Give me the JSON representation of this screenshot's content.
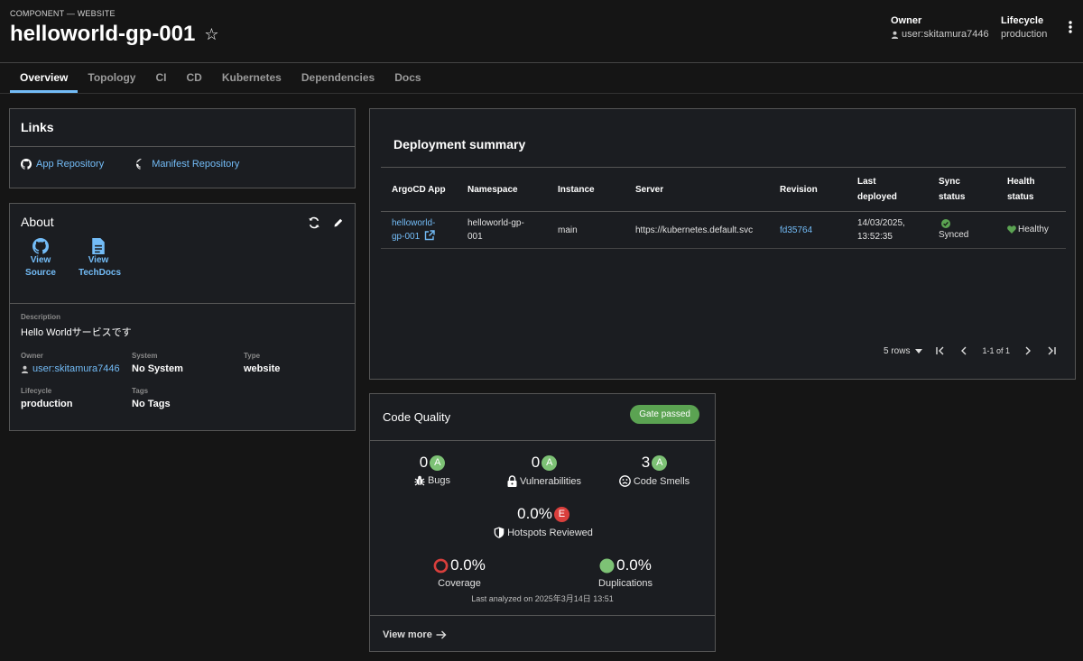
{
  "header": {
    "kind": "COMPONENT — WEBSITE",
    "title": "helloworld-gp-001",
    "owner_label": "Owner",
    "owner_value": "user:skitamura7446",
    "lifecycle_label": "Lifecycle",
    "lifecycle_value": "production"
  },
  "tabs": [
    "Overview",
    "Topology",
    "CI",
    "CD",
    "Kubernetes",
    "Dependencies",
    "Docs"
  ],
  "links": {
    "title": "Links",
    "items": [
      "App Repository",
      "Manifest Repository"
    ]
  },
  "about": {
    "title": "About",
    "view_source": "View Source",
    "view_techdocs": "View TechDocs",
    "description_label": "Description",
    "description": "Hello Worldサービスです",
    "owner_label": "Owner",
    "owner": "user:skitamura7446",
    "system_label": "System",
    "system": "No System",
    "type_label": "Type",
    "type": "website",
    "lifecycle_label": "Lifecycle",
    "lifecycle": "production",
    "tags_label": "Tags",
    "tags": "No Tags"
  },
  "deployment": {
    "title": "Deployment summary",
    "columns": [
      "ArgoCD App",
      "Namespace",
      "Instance",
      "Server",
      "Revision",
      "Last deployed",
      "Sync status",
      "Health status"
    ],
    "row": {
      "app": "helloworld-gp-001",
      "namespace": "helloworld-gp-001",
      "instance": "main",
      "server": "https://kubernetes.default.svc",
      "revision": "fd35764",
      "last_deployed_date": "14/03/2025,",
      "last_deployed_time": "13:52:35",
      "sync": "Synced",
      "health": "Healthy"
    },
    "rows_per_page": "5 rows",
    "page_info": "1-1 of 1"
  },
  "code_quality": {
    "title": "Code Quality",
    "gate": "Gate passed",
    "bugs_value": "0",
    "bugs_grade": "A",
    "bugs_label": "Bugs",
    "vuln_value": "0",
    "vuln_grade": "A",
    "vuln_label": "Vulnerabilities",
    "smells_value": "3",
    "smells_grade": "A",
    "smells_label": "Code Smells",
    "hotspots_value": "0.0%",
    "hotspots_grade": "E",
    "hotspots_label": "Hotspots Reviewed",
    "coverage_value": "0.0%",
    "coverage_label": "Coverage",
    "dup_value": "0.0%",
    "dup_label": "Duplications",
    "analyzed": "Last analyzed on 2025年3月14日 13:51",
    "view_more": "View more"
  },
  "colors": {
    "accent": "#73bcf7",
    "success": "#5ba352",
    "grade_a": "#7dc275",
    "grade_e": "#d93f3c"
  }
}
